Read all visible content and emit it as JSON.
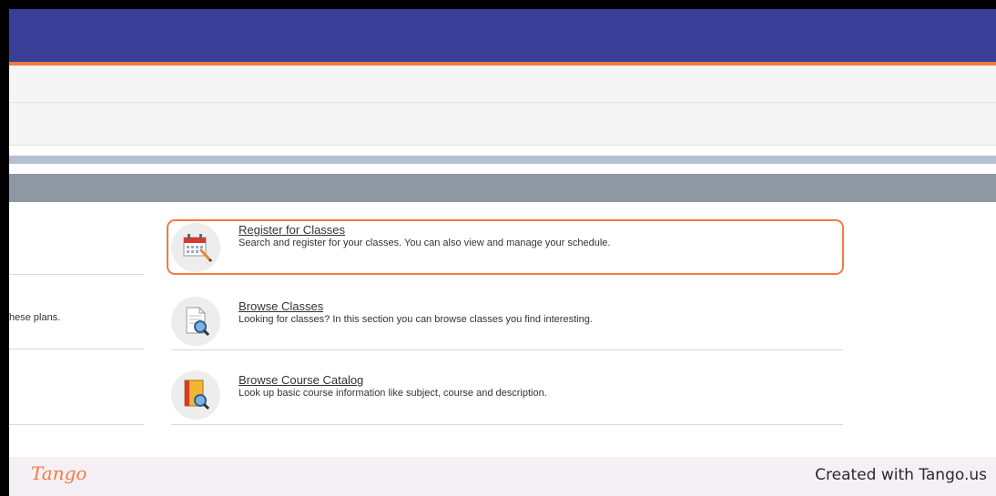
{
  "left_panel": {
    "text_row2": "hese plans."
  },
  "items": [
    {
      "title": "Register for Classes",
      "description": "Search and register for your classes. You can also view and manage your schedule.",
      "icon": "calendar-pencil-icon"
    },
    {
      "title": "Browse Classes",
      "description": "Looking for classes? In this section you can browse classes you find interesting.",
      "icon": "document-magnifier-icon"
    },
    {
      "title": "Browse Course Catalog",
      "description": "Look up basic course information like subject, course and description.",
      "icon": "book-magnifier-icon"
    }
  ],
  "footer": {
    "logo": "Tango",
    "credit": "Created with Tango.us"
  },
  "colors": {
    "header": "#3a3e96",
    "accent": "#f07b41",
    "section_band": "#8d98a2"
  }
}
